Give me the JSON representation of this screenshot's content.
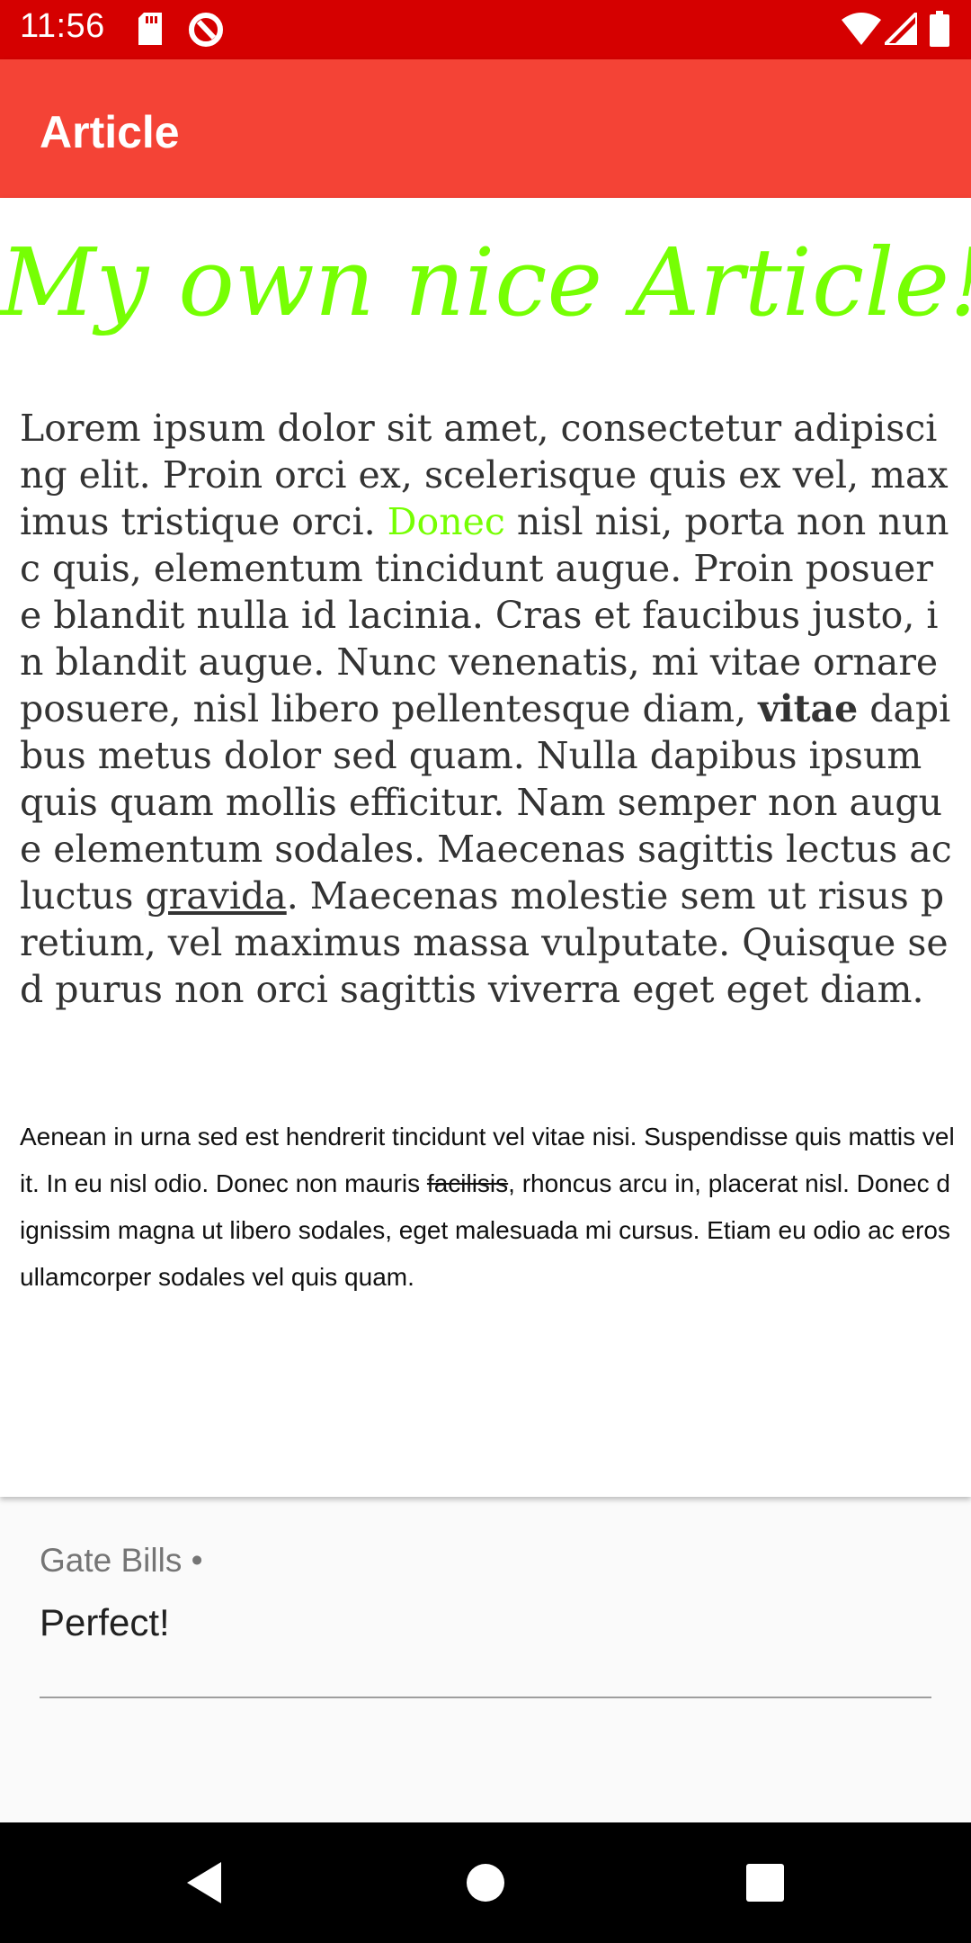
{
  "status_bar": {
    "time": "11:56",
    "icons": [
      "sd-card-icon",
      "sync-icon",
      "wifi-icon",
      "signal-icon",
      "battery-icon"
    ]
  },
  "app_bar": {
    "title": "Article"
  },
  "article": {
    "heading": "My own nice Article!",
    "paragraph1": {
      "part1": "Lorem ipsum dolor sit amet, consectetur adipiscing elit. Proin orci ex, scelerisque quis ex vel, maximus tristique orci. ",
      "link_green": "Donec",
      "part2": " nisl nisi, porta non nunc quis, elementum tincidunt augue. Proin posuere blandit nulla id lacinia. Cras et faucibus justo, in blandit augue. Nunc venenatis, mi vitae ornare  posuere, nisl libero pellentesque diam, ",
      "bold": "vitae",
      "part3": " dapibus metus dolor sed quam. Nulla dapibus ipsum quis quam mollis efficitur. Nam semper non augue elementum sodales. Maecenas sagittis lectus ac luctus ",
      "underlined": "gravida",
      "part4": ". Maecenas molestie sem ut risus pretium, vel maximus massa vulputate. Quisque sed purus non orci sagittis viverra eget eget diam."
    },
    "paragraph2": {
      "part1": "Aenean in urna sed est hendrerit tincidunt vel vitae nisi. Suspendisse quis mattis velit. In eu nisl odio. Donec non mauris ",
      "strikethrough": "facilisis",
      "part2": ", rhoncus arcu in, placerat nisl. Donec dignissim magna ut libero sodales, eget malesuada mi cursus. Etiam eu odio ac eros ullamcorper sodales vel quis quam."
    }
  },
  "comment": {
    "author": "Gate Bills •",
    "text": "Perfect!"
  },
  "colors": {
    "status_bar": "#d50000",
    "app_bar": "#f44336",
    "accent_green": "#76ff03"
  }
}
